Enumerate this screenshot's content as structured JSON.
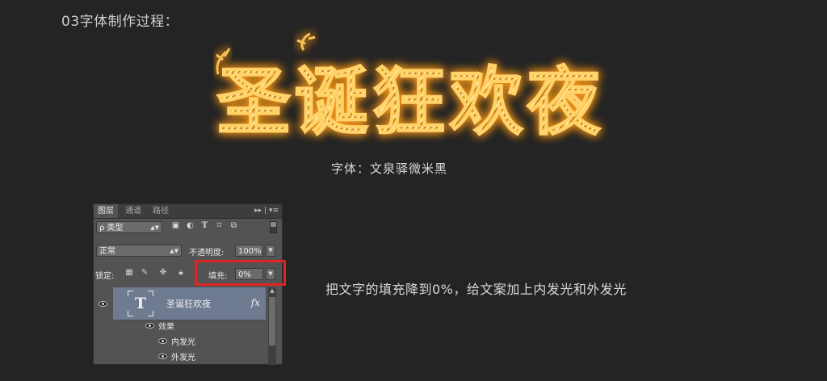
{
  "step_title": "03字体制作过程：",
  "artwork_title": "圣诞狂欢夜",
  "font_caption": "字体：文泉驿微米黑",
  "description": "把文字的填充降到0%，给文案加上内发光和外发光",
  "colors": {
    "background": "#242424",
    "glow": "#f5b63a",
    "highlight_box": "#e02323"
  },
  "panel": {
    "tabs": [
      "图层",
      "通道",
      "路径"
    ],
    "tab_menu_icons": "▸▸ | ▾≡",
    "filter": {
      "label": "ρ 类型",
      "icons": [
        "image-filter-icon",
        "adjustment-filter-icon",
        "type-filter-icon",
        "shape-filter-icon",
        "smart-object-filter-icon"
      ]
    },
    "blend_mode": "正常",
    "opacity_label": "不透明度:",
    "opacity_value": "100%",
    "lock_label": "锁定:",
    "lock_icons": [
      "lock-transparent-icon",
      "lock-paint-icon",
      "lock-move-icon",
      "lock-all-icon"
    ],
    "fill_label": "填充:",
    "fill_value": "0%",
    "layer": {
      "thumb_glyph": "T",
      "name": "圣诞狂欢夜",
      "fx": "fx"
    },
    "effects_label": "效果",
    "effects": [
      "内发光",
      "外发光"
    ]
  }
}
